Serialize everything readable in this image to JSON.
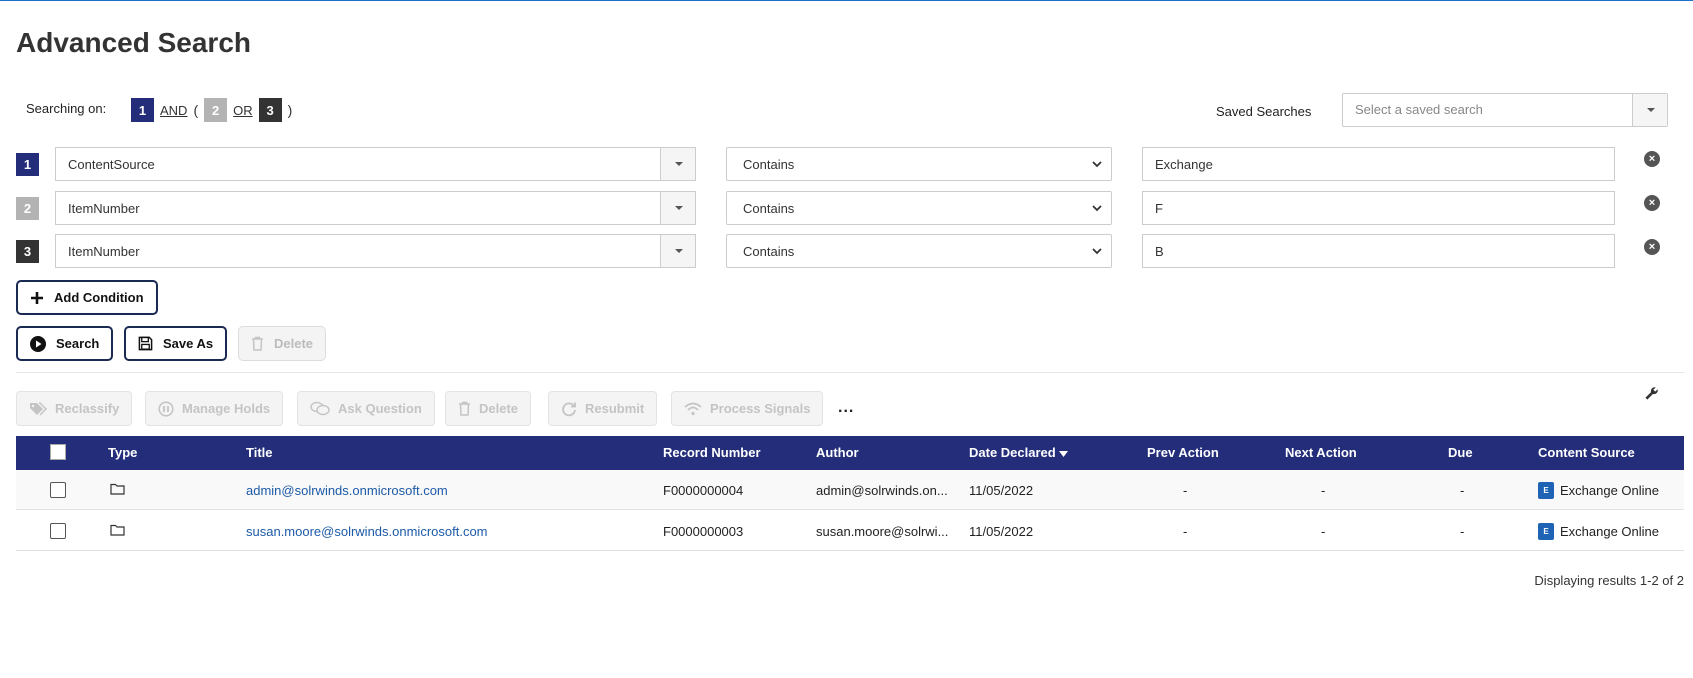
{
  "page": {
    "title": "Advanced Search"
  },
  "searching": {
    "label": "Searching on:",
    "badge1": "1",
    "op1": "AND",
    "paren_open": "(",
    "badge2": "2",
    "op2": "OR",
    "badge3": "3",
    "paren_close": ")"
  },
  "saved": {
    "label": "Saved Searches",
    "placeholder": "Select a saved search"
  },
  "conditions": [
    {
      "num": "1",
      "field": "ContentSource",
      "operator": "Contains",
      "value": "Exchange"
    },
    {
      "num": "2",
      "field": "ItemNumber",
      "operator": "Contains",
      "value": "F"
    },
    {
      "num": "3",
      "field": "ItemNumber",
      "operator": "Contains",
      "value": "B"
    }
  ],
  "buttons": {
    "add_condition": "Add Condition",
    "search": "Search",
    "save_as": "Save As",
    "delete": "Delete"
  },
  "actions": {
    "reclassify": "Reclassify",
    "manage_holds": "Manage Holds",
    "ask_question": "Ask Question",
    "delete": "Delete",
    "resubmit": "Resubmit",
    "process_signals": "Process Signals",
    "more": "..."
  },
  "table": {
    "columns": {
      "type": "Type",
      "title": "Title",
      "record_number": "Record Number",
      "author": "Author",
      "date_declared": "Date Declared",
      "prev_action": "Prev Action",
      "next_action": "Next Action",
      "due": "Due",
      "content_source": "Content Source"
    },
    "rows": [
      {
        "title": "admin@solrwinds.onmicrosoft.com",
        "record_number": "F0000000004",
        "author": "admin@solrwinds.on...",
        "date_declared": "11/05/2022",
        "prev_action": "-",
        "next_action": "-",
        "due": "-",
        "content_source": "Exchange Online"
      },
      {
        "title": "susan.moore@solrwinds.onmicrosoft.com",
        "record_number": "F0000000003",
        "author": "susan.moore@solrwi...",
        "date_declared": "11/05/2022",
        "prev_action": "-",
        "next_action": "-",
        "due": "-",
        "content_source": "Exchange Online"
      }
    ],
    "paging": "Displaying results 1-2 of 2"
  },
  "colors": {
    "primary": "#232d7a",
    "link": "#1c5aa8",
    "badge2": "#b3b3b3",
    "badge3": "#333333"
  }
}
